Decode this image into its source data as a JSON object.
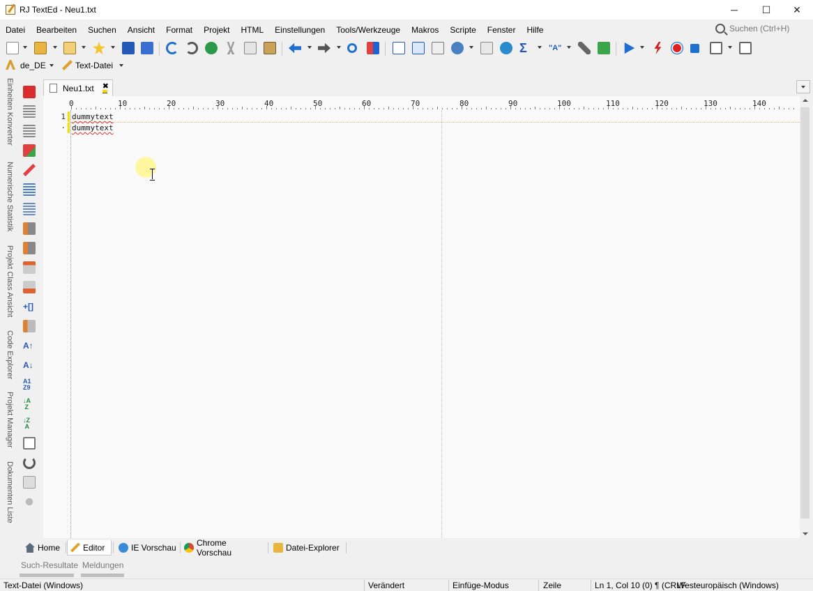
{
  "window": {
    "title": "RJ TextEd - Neu1.txt",
    "minimize_glyph": "─",
    "maximize_glyph": "☐",
    "close_glyph": "✕"
  },
  "menu": [
    "Datei",
    "Bearbeiten",
    "Suchen",
    "Ansicht",
    "Format",
    "Projekt",
    "HTML",
    "Einstellungen",
    "Tools/Werkzeuge",
    "Makros",
    "Scripte",
    "Fenster",
    "Hilfe"
  ],
  "search": {
    "placeholder": "Suchen (Ctrl+H)"
  },
  "toolbar2": {
    "language": "de_DE",
    "filetype": "Text-Datei"
  },
  "side_panels": [
    "Einheiten Konverter",
    "Numerische Statistik",
    "Projekt Class Ansicht",
    "Code Explorer",
    "Projekt Manager",
    "Dokumenten Liste"
  ],
  "document_tab": {
    "label": "Neu1.txt",
    "close_glyph": "✖"
  },
  "ruler": {
    "labels": [
      "0",
      "10",
      "20",
      "30",
      "40",
      "50",
      "60",
      "70",
      "80",
      "90",
      "100",
      "110",
      "120",
      "130",
      "140"
    ]
  },
  "editor": {
    "lines": [
      {
        "number": "1",
        "text": "dummytext"
      },
      {
        "number": "·",
        "text": "dummytext"
      }
    ]
  },
  "bottom_tabs": [
    "Home",
    "Editor",
    "IE Vorschau",
    "Chrome Vorschau",
    "Datei-Explorer"
  ],
  "panel_tabs": [
    "Such-Resultate",
    "Meldungen"
  ],
  "status": {
    "filetype": "Text-Datei (Windows)",
    "modified": "Verändert",
    "mode": "Einfüge-Modus",
    "line_mode": "Zeile",
    "position": "Ln 1, Col 10 (0) ¶ (CRLF",
    "encoding": "Westeuropäisch (Windows)"
  },
  "colors": {
    "accent_blue": "#1f6fd0",
    "save_blue": "#2458b8",
    "modified_marker": "#f4e000",
    "spell_error": "#e03030"
  }
}
